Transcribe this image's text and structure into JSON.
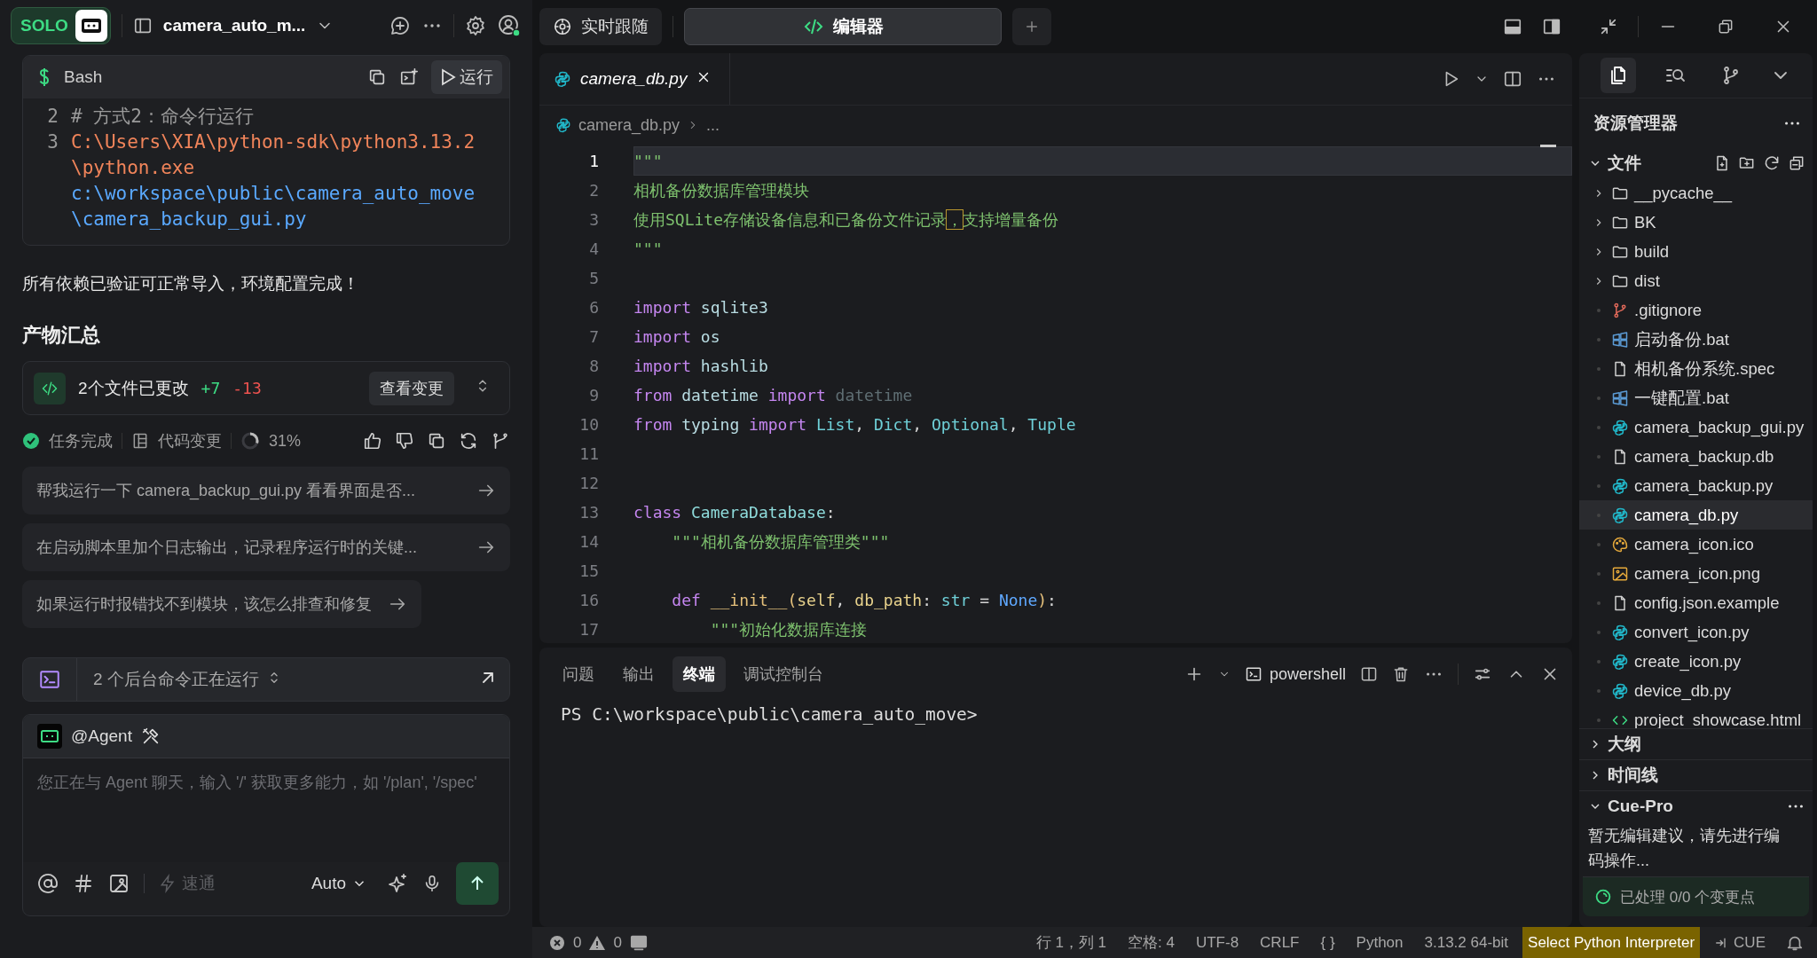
{
  "app_header": {
    "logo_text": "SOLO",
    "project": "camera_auto_m..."
  },
  "chat": {
    "code_block": {
      "language": "Bash",
      "run_label": "运行",
      "lines": [
        {
          "number": "2",
          "tokens": [
            {
              "kind": "comment",
              "text": "# 方式2：命令行运行"
            }
          ]
        },
        {
          "number": "3",
          "tokens": [
            {
              "kind": "exe",
              "text": "C:\\Users\\XIA\\python-sdk\\python3.13.2\\python.exe"
            },
            {
              "kind": "script",
              "text": "c:\\workspace\\public\\camera_auto_move\\camera_backup_gui.py"
            }
          ]
        }
      ]
    },
    "message": "所有依赖已验证可正常导入，环境配置完成！",
    "summary_heading": "产物汇总",
    "changes": {
      "title": "2个文件已更改",
      "added": "+7",
      "removed": "-13",
      "button": "查看变更"
    },
    "status": {
      "done": "任务完成",
      "code_changes": "代码变更",
      "progress": "31%"
    },
    "suggestions": [
      "帮我运行一下 camera_backup_gui.py 看看界面是否...",
      "在启动脚本里加个日志输出，记录程序运行时的关键...",
      "如果运行时报错找不到模块，该怎么排查和修复"
    ],
    "background": "2 个后台命令正在运行",
    "composer": {
      "agent": "@Agent",
      "placeholder": "您正在与 Agent 聊天，输入 '/' 获取更多能力，如 '/plan', '/spec'",
      "mode": "速通",
      "mode_disabled": true,
      "model": "Auto"
    }
  },
  "view_tabs": [
    {
      "label": "实时跟随",
      "selected": false
    },
    {
      "label": "编辑器",
      "selected": true
    }
  ],
  "editor": {
    "filename": "camera_db.py",
    "breadcrumb": "camera_db.py",
    "breadcrumb_more": "...",
    "lines": [
      {
        "number": "1",
        "current": true,
        "tokens": [
          {
            "kind": "string",
            "text": "\"\"\""
          }
        ]
      },
      {
        "number": "2",
        "current": false,
        "tokens": [
          {
            "kind": "string",
            "text": "相机备份数据库管理模块"
          }
        ]
      },
      {
        "number": "3",
        "current": false,
        "tokens": [
          {
            "kind": "string",
            "text": "使用SQLite存储设备信息和已备份文件记录"
          },
          {
            "kind": "match",
            "text": "，"
          },
          {
            "kind": "string",
            "text": "支持增量备份"
          }
        ]
      },
      {
        "number": "4",
        "current": false,
        "tokens": [
          {
            "kind": "string",
            "text": "\"\"\""
          }
        ]
      },
      {
        "number": "5",
        "current": false
      },
      {
        "number": "6",
        "current": false,
        "tokens": [
          {
            "kind": "keyword",
            "text": "import"
          },
          {
            "kind": "module",
            "text": " sqlite3"
          }
        ]
      },
      {
        "number": "7",
        "current": false,
        "tokens": [
          {
            "kind": "keyword",
            "text": "import"
          },
          {
            "kind": "module",
            "text": " os"
          }
        ]
      },
      {
        "number": "8",
        "current": false,
        "tokens": [
          {
            "kind": "keyword",
            "text": "import"
          },
          {
            "kind": "module",
            "text": " hashlib"
          }
        ]
      },
      {
        "number": "9",
        "current": false,
        "tokens": [
          {
            "kind": "keyword",
            "text": "from"
          },
          {
            "kind": "module",
            "text": " datetime"
          },
          {
            "kind": "keyword",
            "text": " import"
          },
          {
            "kind": "dim",
            "text": " datetime"
          }
        ]
      },
      {
        "number": "10",
        "current": false,
        "tokens": [
          {
            "kind": "keyword",
            "text": "from"
          },
          {
            "kind": "module",
            "text": " typing"
          },
          {
            "kind": "keyword",
            "text": " import"
          },
          {
            "kind": "type",
            "text": " List"
          },
          {
            "kind": "punct",
            "text": ","
          },
          {
            "kind": "type",
            "text": " Dict"
          },
          {
            "kind": "punct",
            "text": ","
          },
          {
            "kind": "type",
            "text": " Optional"
          },
          {
            "kind": "punct",
            "text": ","
          },
          {
            "kind": "type",
            "text": " Tuple"
          }
        ]
      },
      {
        "number": "11",
        "current": false
      },
      {
        "number": "12",
        "current": false
      },
      {
        "number": "13",
        "current": false,
        "tokens": [
          {
            "kind": "keyword",
            "text": "class"
          },
          {
            "kind": "cls",
            "text": " CameraDatabase"
          },
          {
            "kind": "punct",
            "text": ":"
          }
        ]
      },
      {
        "number": "14",
        "current": false,
        "tokens": [
          {
            "kind": "string",
            "text": "    \"\"\"相机备份数据库管理类\"\"\""
          }
        ]
      },
      {
        "number": "15",
        "current": false
      },
      {
        "number": "16",
        "current": false,
        "tokens": [
          {
            "kind": "keyword",
            "text": "    def"
          },
          {
            "kind": "fn",
            "text": " __init__"
          },
          {
            "kind": "paren",
            "text": "("
          },
          {
            "kind": "param",
            "text": "self"
          },
          {
            "kind": "punct",
            "text": ","
          },
          {
            "kind": "param",
            "text": " db_path"
          },
          {
            "kind": "punct",
            "text": ":"
          },
          {
            "kind": "type",
            "text": " str"
          },
          {
            "kind": "punct",
            "text": " ="
          },
          {
            "kind": "const",
            "text": " None"
          },
          {
            "kind": "paren",
            "text": ")"
          },
          {
            "kind": "punct",
            "text": ":"
          }
        ]
      },
      {
        "number": "17",
        "current": false,
        "tokens": [
          {
            "kind": "string",
            "text": "        \"\"\"初始化数据库连接"
          }
        ]
      }
    ]
  },
  "terminal": {
    "tabs": [
      {
        "label": "问题",
        "selected": false
      },
      {
        "label": "输出",
        "selected": false
      },
      {
        "label": "终端",
        "selected": true
      },
      {
        "label": "调试控制台",
        "selected": false
      }
    ],
    "shell": "powershell",
    "prompt": "PS C:\\workspace\\public\\camera_auto_move>"
  },
  "explorer": {
    "activity": [
      {
        "kind": "files",
        "selected": true
      },
      {
        "kind": "search",
        "selected": false
      },
      {
        "kind": "branch",
        "selected": false
      }
    ],
    "title": "资源管理器",
    "files": {
      "title": "文件",
      "expanded": true,
      "items": [
        {
          "name": "__pycache__",
          "kind": "folder",
          "selected": false
        },
        {
          "name": "BK",
          "kind": "folder",
          "selected": false
        },
        {
          "name": "build",
          "kind": "folder",
          "selected": false
        },
        {
          "name": "dist",
          "kind": "folder",
          "selected": false
        },
        {
          "name": ".gitignore",
          "kind": "git",
          "selected": false
        },
        {
          "name": "启动备份.bat",
          "kind": "windows",
          "selected": false
        },
        {
          "name": "相机备份系统.spec",
          "kind": "file",
          "selected": false
        },
        {
          "name": "一键配置.bat",
          "kind": "windows",
          "selected": false
        },
        {
          "name": "camera_backup_gui.py",
          "kind": "python",
          "selected": false
        },
        {
          "name": "camera_backup.db",
          "kind": "file",
          "selected": false
        },
        {
          "name": "camera_backup.py",
          "kind": "python",
          "selected": false
        },
        {
          "name": "camera_db.py",
          "kind": "python",
          "selected": true
        },
        {
          "name": "camera_icon.ico",
          "kind": "palette",
          "selected": false
        },
        {
          "name": "camera_icon.png",
          "kind": "image",
          "selected": false
        },
        {
          "name": "config.json.example",
          "kind": "file",
          "selected": false
        },
        {
          "name": "convert_icon.py",
          "kind": "python",
          "selected": false
        },
        {
          "name": "create_icon.py",
          "kind": "python",
          "selected": false
        },
        {
          "name": "device_db.py",
          "kind": "python",
          "selected": false
        },
        {
          "name": "project_showcase.html",
          "kind": "html",
          "selected": false
        }
      ]
    },
    "sections": [
      {
        "title": "大纲",
        "expanded": false
      },
      {
        "title": "时间线",
        "expanded": false
      }
    ],
    "cue_pro": {
      "title": "Cue-Pro",
      "expanded": true,
      "message": "暂无编辑建议，请先进行编码操作...",
      "footer": "已处理 0/0 个变更点"
    }
  },
  "status_bar": {
    "errors": "0",
    "warnings": "0",
    "items": [
      "行 1，列 1",
      "空格: 4",
      "UTF-8",
      "CRLF",
      "{ }",
      "Python",
      "3.13.2 64-bit"
    ],
    "interpreter": "Select Python Interpreter",
    "cue": "CUE"
  }
}
